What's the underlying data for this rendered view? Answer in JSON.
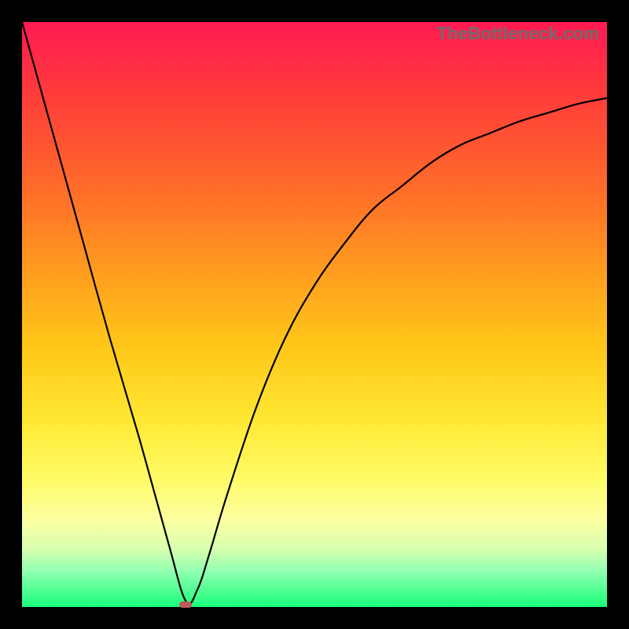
{
  "watermark": "TheBottleneck.com",
  "colors": {
    "frame": "#000000",
    "curve_stroke": "#000000",
    "marker": "#c05a5a"
  },
  "chart_data": {
    "type": "line",
    "title": "",
    "xlabel": "",
    "ylabel": "",
    "xlim": [
      0,
      100
    ],
    "ylim": [
      0,
      100
    ],
    "grid": false,
    "legend": false,
    "axes_visible": false,
    "series": [
      {
        "name": "bottleneck-curve",
        "x": [
          0,
          5,
          10,
          15,
          20,
          25,
          28,
          30,
          32,
          35,
          40,
          45,
          50,
          55,
          60,
          65,
          70,
          75,
          80,
          85,
          90,
          95,
          100
        ],
        "y": [
          100,
          82,
          64,
          46,
          29,
          11,
          1,
          3,
          9,
          19,
          34,
          46,
          55,
          62,
          68,
          72,
          76,
          79,
          81,
          83,
          84.5,
          86,
          87
        ]
      }
    ],
    "annotations": [
      {
        "type": "min-marker",
        "x": 28,
        "y": 0
      }
    ]
  }
}
